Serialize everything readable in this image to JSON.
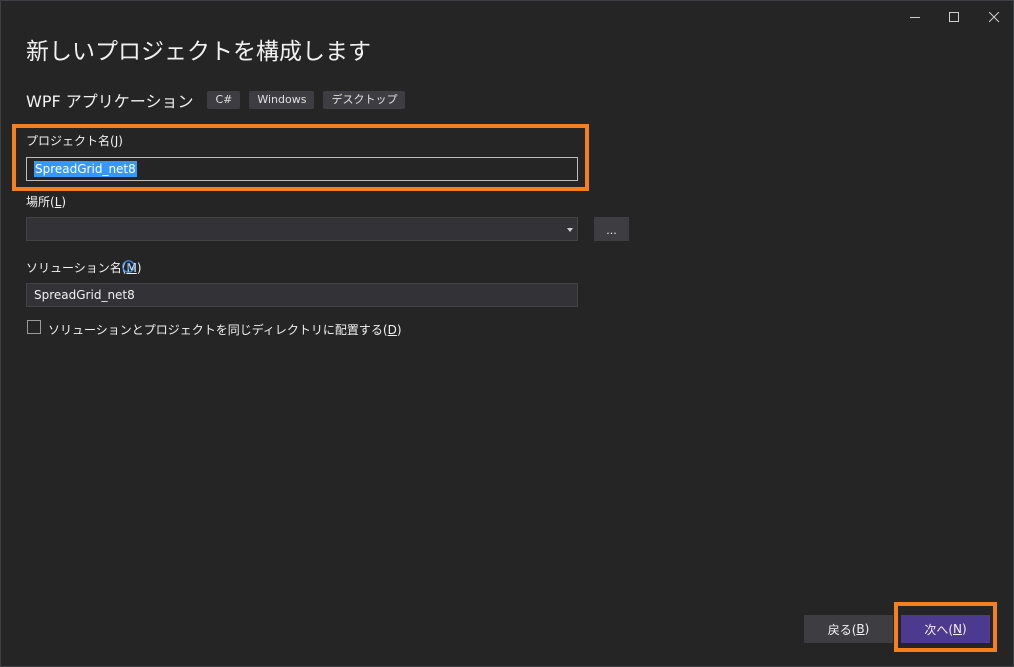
{
  "window": {
    "controls": [
      {
        "name": "minimize",
        "icon": "minimize-icon"
      },
      {
        "name": "maximize",
        "icon": "maximize-icon"
      },
      {
        "name": "close",
        "icon": "close-icon"
      }
    ]
  },
  "page": {
    "title": "新しいプロジェクトを構成します"
  },
  "template": {
    "name": "WPF アプリケーション",
    "tags": [
      "C#",
      "Windows",
      "デスクトップ"
    ]
  },
  "project_name": {
    "label": "プロジェクト名(",
    "accesskey": "J",
    "label_end": ")",
    "value": "SpreadGrid_net8"
  },
  "location": {
    "label": "場所(",
    "accesskey": "L",
    "label_end": ")",
    "value": "",
    "browse_label": "..."
  },
  "solution_name": {
    "label": "ソリューション名(",
    "accesskey": "M",
    "label_end": ")",
    "value": "SpreadGrid_net8",
    "info_icon": "info-icon"
  },
  "same_directory": {
    "label": "ソリューションとプロジェクトを同じディレクトリに配置する(",
    "accesskey": "D",
    "label_end": ")",
    "checked": false
  },
  "footer": {
    "back_label": "戻る(",
    "back_accesskey": "B",
    "next_label": "次へ(",
    "next_accesskey": "N",
    "label_end": ")"
  },
  "colors": {
    "background": "#252526",
    "highlight": "#f7801e",
    "primary_button": "#4b3a8e",
    "selection": "#3399ff"
  }
}
